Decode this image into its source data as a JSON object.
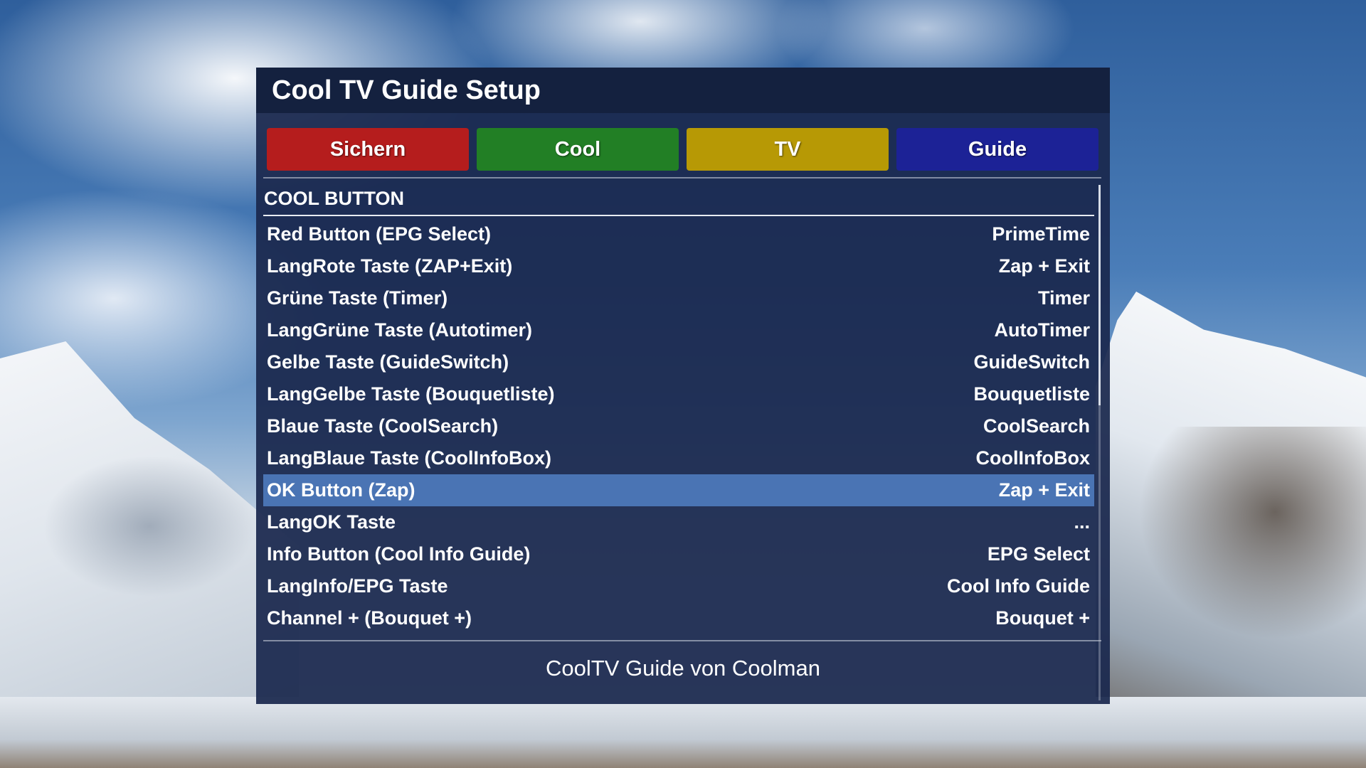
{
  "panel": {
    "title": "Cool TV Guide Setup"
  },
  "color_buttons": [
    {
      "label": "Sichern",
      "color": "#b51d1d"
    },
    {
      "label": "Cool",
      "color": "#227f25"
    },
    {
      "label": "TV",
      "color": "#b79905"
    },
    {
      "label": "Guide",
      "color": "#1c2296"
    }
  ],
  "section": {
    "title": "COOL BUTTON"
  },
  "settings": [
    {
      "label": "Red Button (EPG Select)",
      "value": "PrimeTime"
    },
    {
      "label": "LangRote Taste (ZAP+Exit)",
      "value": "Zap + Exit"
    },
    {
      "label": "Grüne Taste (Timer)",
      "value": "Timer"
    },
    {
      "label": "LangGrüne Taste (Autotimer)",
      "value": "AutoTimer"
    },
    {
      "label": "Gelbe Taste (GuideSwitch)",
      "value": "GuideSwitch"
    },
    {
      "label": "LangGelbe Taste (Bouquetliste)",
      "value": "Bouquetliste"
    },
    {
      "label": "Blaue Taste (CoolSearch)",
      "value": "CoolSearch"
    },
    {
      "label": "LangBlaue Taste (CoolInfoBox)",
      "value": "CoolInfoBox"
    },
    {
      "label": "OK Button (Zap)",
      "value": "Zap + Exit",
      "selected": true
    },
    {
      "label": "LangOK Taste",
      "value": "..."
    },
    {
      "label": "Info Button (Cool Info Guide)",
      "value": "EPG Select"
    },
    {
      "label": "LangInfo/EPG Taste",
      "value": "Cool Info Guide"
    },
    {
      "label": "Channel + (Bouquet +)",
      "value": "Bouquet +"
    }
  ],
  "footer": {
    "text": "CoolTV Guide von Coolman"
  },
  "colors": {
    "panel_bg": "#1a284e",
    "header_bg": "#14213f",
    "selection": "#4a74b4"
  }
}
